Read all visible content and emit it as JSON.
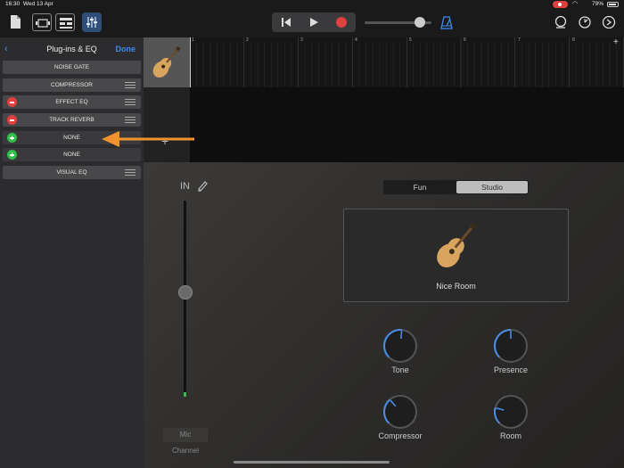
{
  "status_bar": {
    "time": "16:30",
    "date": "Wed 13 Apr",
    "battery": "79%"
  },
  "toolbar": {
    "icons": [
      "document-icon",
      "tracks-view-icon",
      "browser-icon",
      "mixer-icon",
      "rewind-icon",
      "play-icon",
      "record-icon",
      "metronome-icon",
      "loop-icon",
      "timer-icon",
      "settings-icon"
    ]
  },
  "sidebar": {
    "back": "‹",
    "title": "Plug-ins & EQ",
    "done": "Done",
    "slots": [
      {
        "label": "NOISE GATE",
        "action": "none"
      },
      {
        "label": "COMPRESSOR",
        "action": "handle"
      },
      {
        "label": "EFFECT EQ",
        "action": "remove"
      },
      {
        "label": "TRACK REVERB",
        "action": "remove"
      },
      {
        "label": "NONE",
        "action": "add"
      },
      {
        "label": "NONE",
        "action": "add"
      },
      {
        "label": "VISUAL EQ",
        "action": "handle"
      }
    ]
  },
  "ruler": [
    "1",
    "2",
    "3",
    "4",
    "5",
    "6",
    "7",
    "8"
  ],
  "add_track": "+",
  "panel": {
    "in_label": "IN",
    "mic": "Mic",
    "channel": "Channel",
    "fader_level": 0.52,
    "modes": [
      "Fun",
      "Studio"
    ],
    "active_mode": "Studio",
    "room": "Nice Room",
    "knobs": [
      {
        "label": "Tone",
        "value": 0.52
      },
      {
        "label": "Presence",
        "value": 0.5
      },
      {
        "label": "Compressor",
        "value": 0.35
      },
      {
        "label": "Room",
        "value": 0.22
      }
    ]
  },
  "colors": {
    "accent": "#3d8cf3",
    "record": "#e0413e",
    "add": "#30c048",
    "arrow": "#f2922f"
  }
}
